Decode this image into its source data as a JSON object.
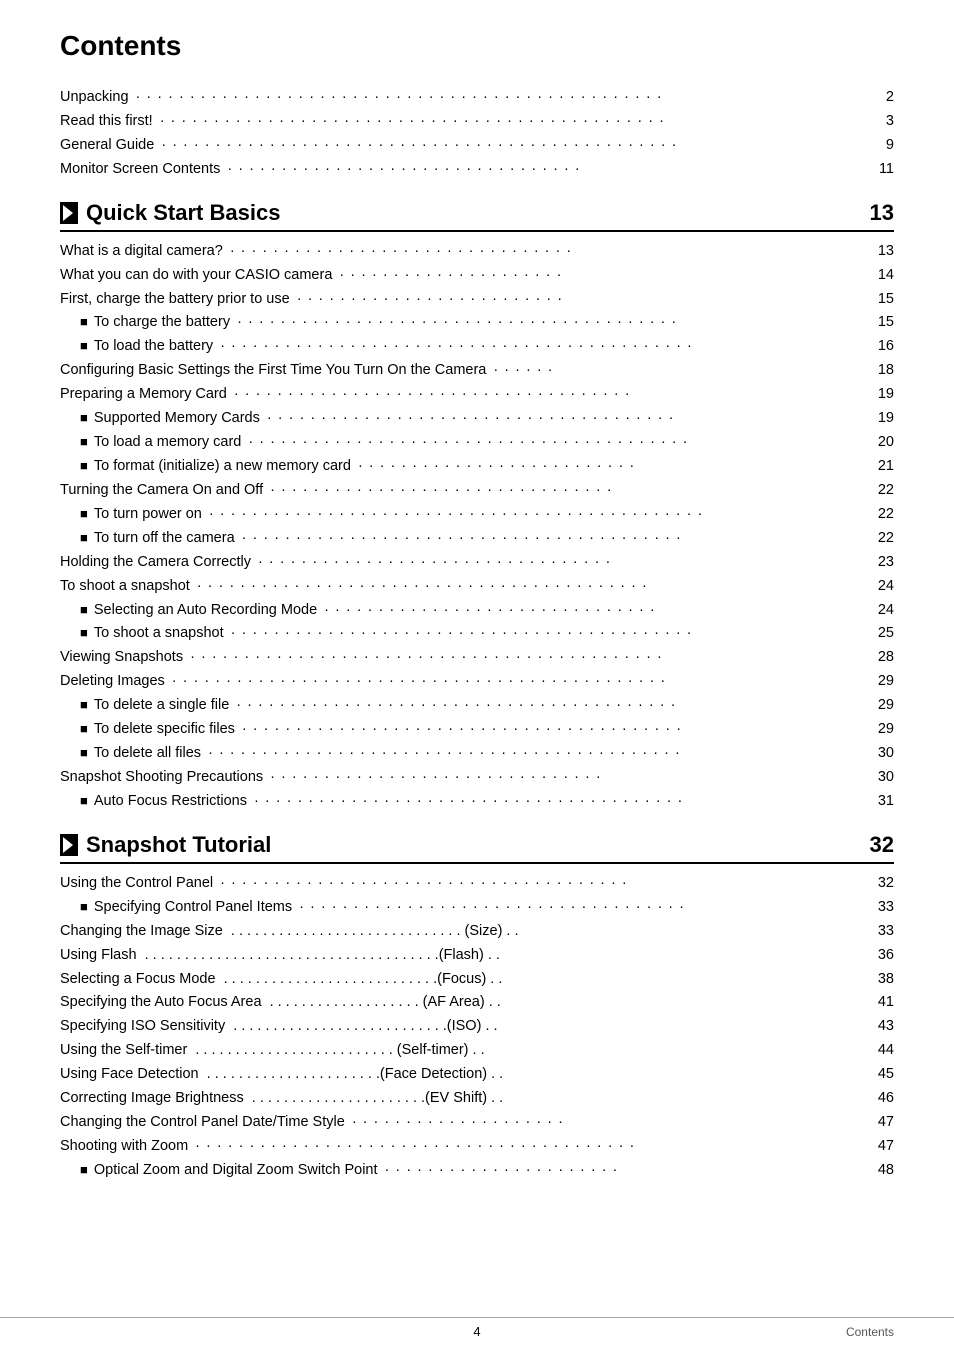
{
  "title": "Contents",
  "sections": [
    {
      "type": "plain",
      "entries": [
        {
          "text": "Unpacking",
          "dots": "· · · · · · · · · · · · · · · · · · · · · · · · · · · · · · · · · · · · · · · · · · · · · · · · ·",
          "page": "2"
        },
        {
          "text": "Read this first!",
          "dots": "· · · · · · · · · · · · · · · · · · · · · · · · · · · · · · · · · · · · · · · · · · · · · · ·",
          "page": "3"
        },
        {
          "text": "General Guide",
          "dots": "· · · · · · · · · · · · · · · · · · · · · · · · · · · · · · · · · · · · · · · · · · · · · · · ·",
          "page": "9"
        },
        {
          "text": "Monitor Screen Contents",
          "dots": "· · · · · · · · · · · · · · · · · · · · · · · · · · · · · · · · · ·",
          "page": "11"
        }
      ]
    },
    {
      "type": "section",
      "title": "Quick Start Basics",
      "page": "13",
      "entries": [
        {
          "type": "plain",
          "text": "What is a digital camera?",
          "dots": "· · · · · · · · · · · · · · · · · · · · · · · · · · · · · · · ·",
          "page": "13"
        },
        {
          "type": "plain",
          "text": "What you can do with your CASIO camera",
          "dots": "· · · · · · · · · · · · · · · · · · · · · ·",
          "page": "14"
        },
        {
          "type": "plain",
          "text": "First, charge the battery prior to use",
          "dots": "· · · · · · · · · · · · · · · · · · · · · · · · ·",
          "page": "15"
        },
        {
          "type": "bullet",
          "text": "To charge the battery",
          "dots": "· · · · · · · · · · · · · · · · · · · · · · · · · · · · · · · · · · · · · · · · · ·",
          "page": "15"
        },
        {
          "type": "bullet",
          "text": "To load the battery",
          "dots": "· · · · · · · · · · · · · · · · · · · · · · · · · · · · · · · · · · · · · · · · · · · ·",
          "page": "16"
        },
        {
          "type": "plain",
          "text": "Configuring Basic Settings the First Time You Turn On the Camera",
          "dots": "· · · · · ·",
          "page": "18"
        },
        {
          "type": "plain",
          "text": "Preparing a Memory Card",
          "dots": "· · · · · · · · · · · · · · · · · · · · · · · · · · · · · · · · · · · · ·",
          "page": "19"
        },
        {
          "type": "bullet",
          "text": "Supported Memory Cards",
          "dots": "· · · · · · · · · · · · · · · · · · · · · · · · · · · · · · · · · · · · · ·",
          "page": "19"
        },
        {
          "type": "bullet",
          "text": "To load a memory card",
          "dots": "· · · · · · · · · · · · · · · · · · · · · · · · · · · · · · · · · · · · · · · · ·",
          "page": "20"
        },
        {
          "type": "bullet",
          "text": "To format (initialize) a new memory card",
          "dots": "· · · · · · · · · · · · · · · · · · · · · · · · · ·",
          "page": "21"
        },
        {
          "type": "plain",
          "text": "Turning the Camera On and Off",
          "dots": "· · · · · · · · · · · · · · · · · · · · · · · · · · · · · · · ·",
          "page": "22"
        },
        {
          "type": "bullet",
          "text": "To turn power on",
          "dots": "· · · · · · · · · · · · · · · · · · · · · · · · · · · · · · · · · · · · · · · · · · · · · ·",
          "page": "22"
        },
        {
          "type": "bullet",
          "text": "To turn off the camera",
          "dots": "· · · · · · · · · · · · · · · · · · · · · · · · · · · · · · · · · · · · · · · · ·",
          "page": "22"
        },
        {
          "type": "plain",
          "text": "Holding the Camera Correctly",
          "dots": "· · · · · · · · · · · · · · · · · · · · · · · · · · · · · · · · ·",
          "page": "23"
        },
        {
          "type": "plain",
          "text": "To shoot a snapshot",
          "dots": "· · · · · · · · · · · · · · · · · · · · · · · · · · · · · · · · · · · · · · · · · ·",
          "page": "24"
        },
        {
          "type": "bullet",
          "text": "Selecting an Auto Recording Mode",
          "dots": "· · · · · · · · · · · · · · · · · · · · · · · · · · · · · · ·",
          "page": "24"
        },
        {
          "type": "bullet",
          "text": "To shoot a snapshot",
          "dots": "· · · · · · · · · · · · · · · · · · · · · · · · · · · · · · · · · · · · · · · · · · ·",
          "page": "25"
        },
        {
          "type": "plain",
          "text": "Viewing Snapshots",
          "dots": "· · · · · · · · · · · · · · · · · · · · · · · · · · · · · · · · · · · · · · · · · · · ·",
          "page": "28"
        },
        {
          "type": "plain",
          "text": "Deleting Images",
          "dots": "· · · · · · · · · · · · · · · · · · · · · · · · · · · · · · · · · · · · · · · · · · · · · ·",
          "page": "29"
        },
        {
          "type": "bullet",
          "text": "To delete a single file",
          "dots": "· · · · · · · · · · · · · · · · · · · · · · · · · · · · · · · · · · · · · · · · ·",
          "page": "29"
        },
        {
          "type": "bullet",
          "text": "To delete specific files",
          "dots": "· · · · · · · · · · · · · · · · · · · · · · · · · · · · · · · · · · · · · · · · ·",
          "page": "29"
        },
        {
          "type": "bullet",
          "text": "To delete all files",
          "dots": "· · · · · · · · · · · · · · · · · · · · · · · · · · · · · · · · · · · · · · · · · · · ·",
          "page": "30"
        },
        {
          "type": "plain",
          "text": "Snapshot Shooting Precautions",
          "dots": "· · · · · · · · · · · · · · · · · · · · · · · · · · · · · · ·",
          "page": "30"
        },
        {
          "type": "bullet",
          "text": "Auto Focus Restrictions",
          "dots": "· · · · · · · · · · · · · · · · · · · · · · · · · · · · · · · · · · · · · · · ·",
          "page": "31"
        }
      ]
    },
    {
      "type": "section",
      "title": "Snapshot Tutorial",
      "page": "32",
      "entries": [
        {
          "type": "plain",
          "text": "Using the Control Panel",
          "dots": "· · · · · · · · · · · · · · · · · · · · · · · · · · · · · · · · · · · · · ·",
          "page": "32"
        },
        {
          "type": "bullet",
          "text": "Specifying Control Panel Items",
          "dots": "· · · · · · · · · · · · · · · · · · · · · · · · · · · · · · · · · · ·",
          "page": "33"
        },
        {
          "type": "plain",
          "text": "Changing the Image Size",
          "suffix": "(Size)",
          "dots": "· · · · · · · · · · · · · · · · · · · · · · · · · · · · · · ·",
          "page": "33"
        },
        {
          "type": "plain",
          "text": "Using Flash",
          "suffix": "(Flash)",
          "dots": "· · · · · · · · · · · · · · · · · · · · · · · · · · · · · · · · · · · · · · · · ·",
          "page": "36"
        },
        {
          "type": "plain",
          "text": "Selecting a Focus Mode",
          "suffix": "(Focus)",
          "dots": "· · · · · · · · · · · · · · · · · · · · · · · · · · · · · ·",
          "page": "38"
        },
        {
          "type": "plain",
          "text": "Specifying the Auto Focus Area",
          "suffix": "(AF Area)",
          "dots": "· · · · · · · · · · · · · · · · · · · · ·",
          "page": "41"
        },
        {
          "type": "plain",
          "text": "Specifying ISO Sensitivity",
          "suffix": "(ISO)",
          "dots": "· · · · · · · · · · · · · · · · · · · · · · · · · · · · · · · · ·",
          "page": "43"
        },
        {
          "type": "plain",
          "text": "Using the Self-timer",
          "suffix": "(Self-timer)",
          "dots": "· · · · · · · · · · · · · · · · · · · · · · · · · · · · · ·",
          "page": "44"
        },
        {
          "type": "plain",
          "text": "Using Face Detection",
          "suffix": "(Face Detection)",
          "dots": "· · · · · · · · · · · · · · · · · · · · · · · · · ·",
          "page": "45"
        },
        {
          "type": "plain",
          "text": "Correcting Image Brightness",
          "suffix": "(EV Shift)",
          "dots": "· · · · · · · · · · · · · · · · · · · · · · · · · · · ·",
          "page": "46"
        },
        {
          "type": "plain",
          "text": "Changing the Control Panel Date/Time Style",
          "dots": "· · · · · · · · · · · · · · · · · · · ·",
          "page": "47"
        },
        {
          "type": "plain",
          "text": "Shooting with Zoom",
          "dots": "· · · · · · · · · · · · · · · · · · · · · · · · · · · · · · · · · · · · · · · · ·",
          "page": "47"
        },
        {
          "type": "bullet",
          "text": "Optical Zoom and Digital Zoom Switch Point",
          "dots": "· · · · · · · · · · · · · · · · · · · · · ·",
          "page": "48"
        }
      ]
    }
  ],
  "footer": {
    "page_number": "4",
    "label": "Contents"
  }
}
